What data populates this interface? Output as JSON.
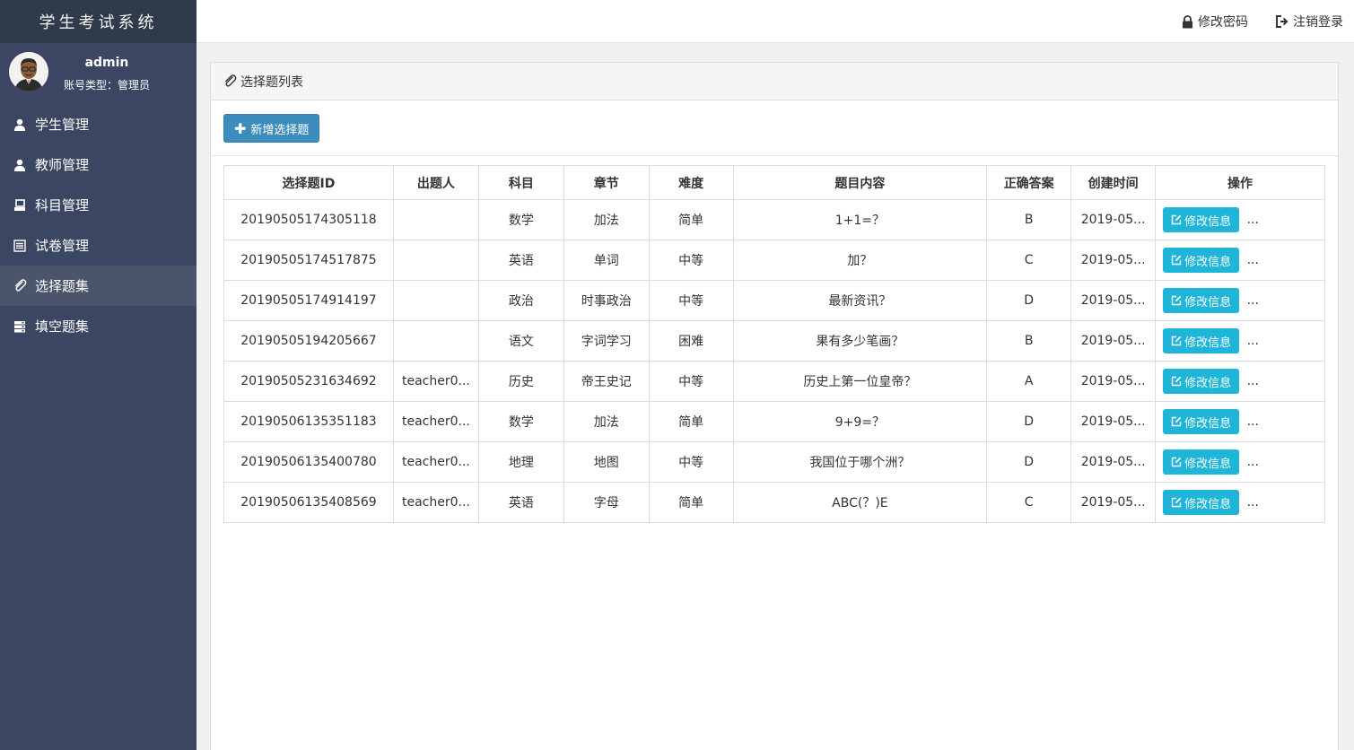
{
  "app": {
    "title": "学生考试系统"
  },
  "user": {
    "name": "admin",
    "role": "账号类型：管理员"
  },
  "sidebar": {
    "items": [
      {
        "label": "学生管理",
        "icon": "user-icon"
      },
      {
        "label": "教师管理",
        "icon": "user-icon"
      },
      {
        "label": "科目管理",
        "icon": "desktop-icon"
      },
      {
        "label": "试卷管理",
        "icon": "list-icon"
      },
      {
        "label": "选择题集",
        "icon": "paperclip-icon",
        "active": true
      },
      {
        "label": "填空题集",
        "icon": "server-icon"
      }
    ]
  },
  "header": {
    "change_password": "修改密码",
    "logout": "注销登录"
  },
  "panel": {
    "title": "选择题列表",
    "add_button": "新增选择题"
  },
  "table": {
    "headers": [
      "选择题ID",
      "出题人",
      "科目",
      "章节",
      "难度",
      "题目内容",
      "正确答案",
      "创建时间",
      "操作"
    ],
    "edit_label": "修改信息",
    "more_label": "...",
    "rows": [
      {
        "id": "20190505174305118",
        "author": "",
        "subject": "数学",
        "chapter": "加法",
        "difficulty": "简单",
        "content": "1+1=？",
        "answer": "B",
        "created": "2019-05..."
      },
      {
        "id": "20190505174517875",
        "author": "",
        "subject": "英语",
        "chapter": "单词",
        "difficulty": "中等",
        "content": "加？",
        "answer": "C",
        "created": "2019-05..."
      },
      {
        "id": "20190505174914197",
        "author": "",
        "subject": "政治",
        "chapter": "时事政治",
        "difficulty": "中等",
        "content": "最新资讯？",
        "answer": "D",
        "created": "2019-05..."
      },
      {
        "id": "20190505194205667",
        "author": "",
        "subject": "语文",
        "chapter": "字词学习",
        "difficulty": "困难",
        "content": "果有多少笔画？",
        "answer": "B",
        "created": "2019-05..."
      },
      {
        "id": "20190505231634692",
        "author": "teacher0...",
        "subject": "历史",
        "chapter": "帝王史记",
        "difficulty": "中等",
        "content": "历史上第一位皇帝？",
        "answer": "A",
        "created": "2019-05..."
      },
      {
        "id": "20190506135351183",
        "author": "teacher0...",
        "subject": "数学",
        "chapter": "加法",
        "difficulty": "简单",
        "content": "9+9=？",
        "answer": "D",
        "created": "2019-05..."
      },
      {
        "id": "20190506135400780",
        "author": "teacher0...",
        "subject": "地理",
        "chapter": "地图",
        "difficulty": "中等",
        "content": "我国位于哪个洲？",
        "answer": "D",
        "created": "2019-05..."
      },
      {
        "id": "20190506135408569",
        "author": "teacher0...",
        "subject": "英语",
        "chapter": "字母",
        "difficulty": "简单",
        "content": "ABC(？)E",
        "answer": "C",
        "created": "2019-05..."
      }
    ]
  }
}
